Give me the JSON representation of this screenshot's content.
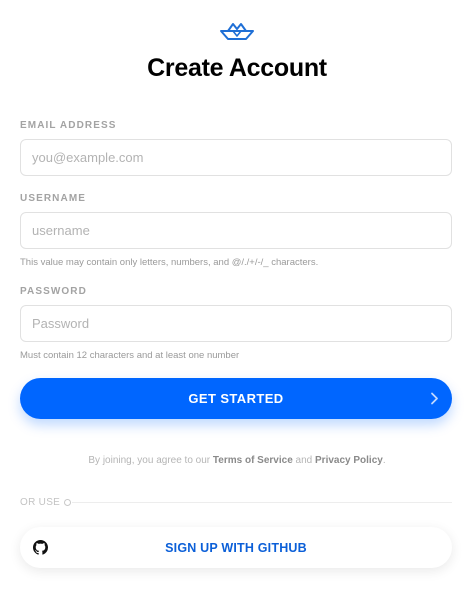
{
  "brand": {
    "logo_icon": "paper-boat-icon",
    "accent_color": "#0066ff"
  },
  "page": {
    "title": "Create Account"
  },
  "form": {
    "email": {
      "label": "EMAIL ADDRESS",
      "placeholder": "you@example.com",
      "value": ""
    },
    "username": {
      "label": "USERNAME",
      "placeholder": "username",
      "value": "",
      "hint": "This value may contain only letters, numbers, and @/./+/-/_ characters."
    },
    "password": {
      "label": "PASSWORD",
      "placeholder": "Password",
      "value": "",
      "hint": "Must contain 12 characters and at least one number"
    },
    "submit": {
      "label": "GET STARTED",
      "icon": "chevron-right-icon"
    }
  },
  "legal": {
    "prefix": "By joining, you agree to our",
    "terms_label": "Terms of Service",
    "conjunction": "and",
    "privacy_label": "Privacy Policy",
    "suffix": "."
  },
  "divider": {
    "text": "OR USE"
  },
  "oauth": {
    "github_label": "SIGN UP WITH GITHUB",
    "icon": "github-icon"
  }
}
